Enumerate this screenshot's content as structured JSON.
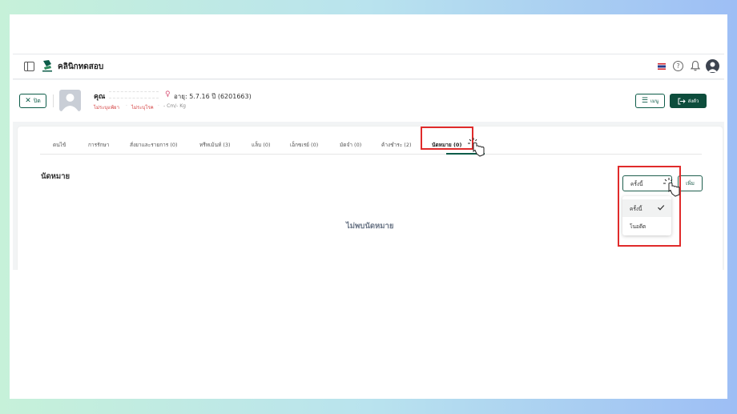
{
  "header": {
    "app_title": "คลินิกทดสอบ",
    "help_symbol": "?"
  },
  "patient": {
    "name_prefix": "คุณ",
    "gender_symbol": "♀",
    "age_text": "อายุ: 5.7.16 ปี",
    "hn": "(6201663)",
    "allergy": "ไม่ระบุแพ้ยา",
    "disease": "ไม่ระบุโรค",
    "measurements": "- Cm/- Kg",
    "separator": "·",
    "close_label": "ปิด",
    "menu_label": "เมนู",
    "queue_label": "ส่งตัว"
  },
  "tabs": [
    {
      "label": "ดนไข้"
    },
    {
      "label": "การรักษา"
    },
    {
      "label": "สั่งยาและรายการ (0)"
    },
    {
      "label": "ทรีทเม้นท์ (3)"
    },
    {
      "label": "แล็บ (0)"
    },
    {
      "label": "เอ็กซเรย์ (0)"
    },
    {
      "label": "มัดจำ (0)"
    },
    {
      "label": "ค้างชำระ (2)"
    },
    {
      "label": "นัดหมาย (0)",
      "active": true
    }
  ],
  "appointments": {
    "title": "นัดหมาย",
    "empty_message": "ไม่พบนัดหมาย",
    "add_label": "เพิ่ม",
    "filter": {
      "selected": "ครั้งนี้",
      "options": [
        "ครั้งนี้",
        "โนอดีต"
      ]
    }
  },
  "colors": {
    "primary": "#0d5c49",
    "highlight": "#e02b2b",
    "warning_text": "#d23a3a"
  }
}
